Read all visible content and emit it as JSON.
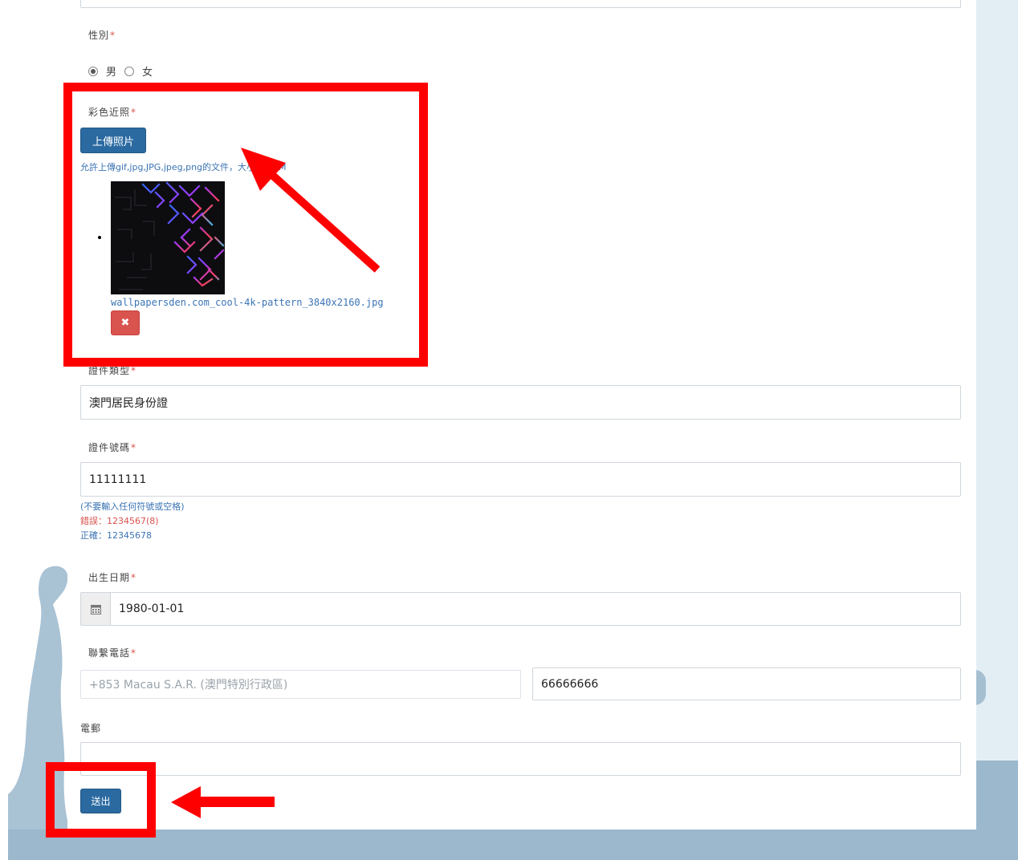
{
  "form": {
    "gender": {
      "label": "性別",
      "required": "*",
      "options": [
        {
          "label": "男",
          "checked": true
        },
        {
          "label": "女",
          "checked": false
        }
      ]
    },
    "photo": {
      "label": "彩色近照",
      "required": "*",
      "upload_button": "上傳照片",
      "hint": "允許上傳gif,jpg,JPG,jpeg,png的文件，大小限制5M",
      "filename": "wallpapersden.com_cool-4k-pattern_3840x2160.jpg",
      "delete_icon": "✖"
    },
    "id_type": {
      "label": "證件類型",
      "required": "*",
      "value": "澳門居民身份證"
    },
    "id_number": {
      "label": "證件號碼",
      "required": "*",
      "value": "11111111",
      "note": "(不要輸入任何符號或空格)",
      "wrong_example": "錯誤：1234567(8)",
      "correct_example": "正確：12345678"
    },
    "birth_date": {
      "label": "出生日期",
      "required": "*",
      "value": "1980-01-01",
      "icon": "calendar-icon"
    },
    "phone": {
      "label": "聯繫電話",
      "required": "*",
      "prefix_placeholder": "+853 Macau S.A.R. (澳門特別行政區)",
      "number": "66666666"
    },
    "email": {
      "label": "電郵",
      "value": ""
    },
    "submit_label": "送出"
  },
  "colors": {
    "primary": "#2b6aa1",
    "danger": "#d9534f",
    "annotation": "#ff0000",
    "hint_text": "#3b74b4",
    "background_blue": "#9cb8cc"
  }
}
